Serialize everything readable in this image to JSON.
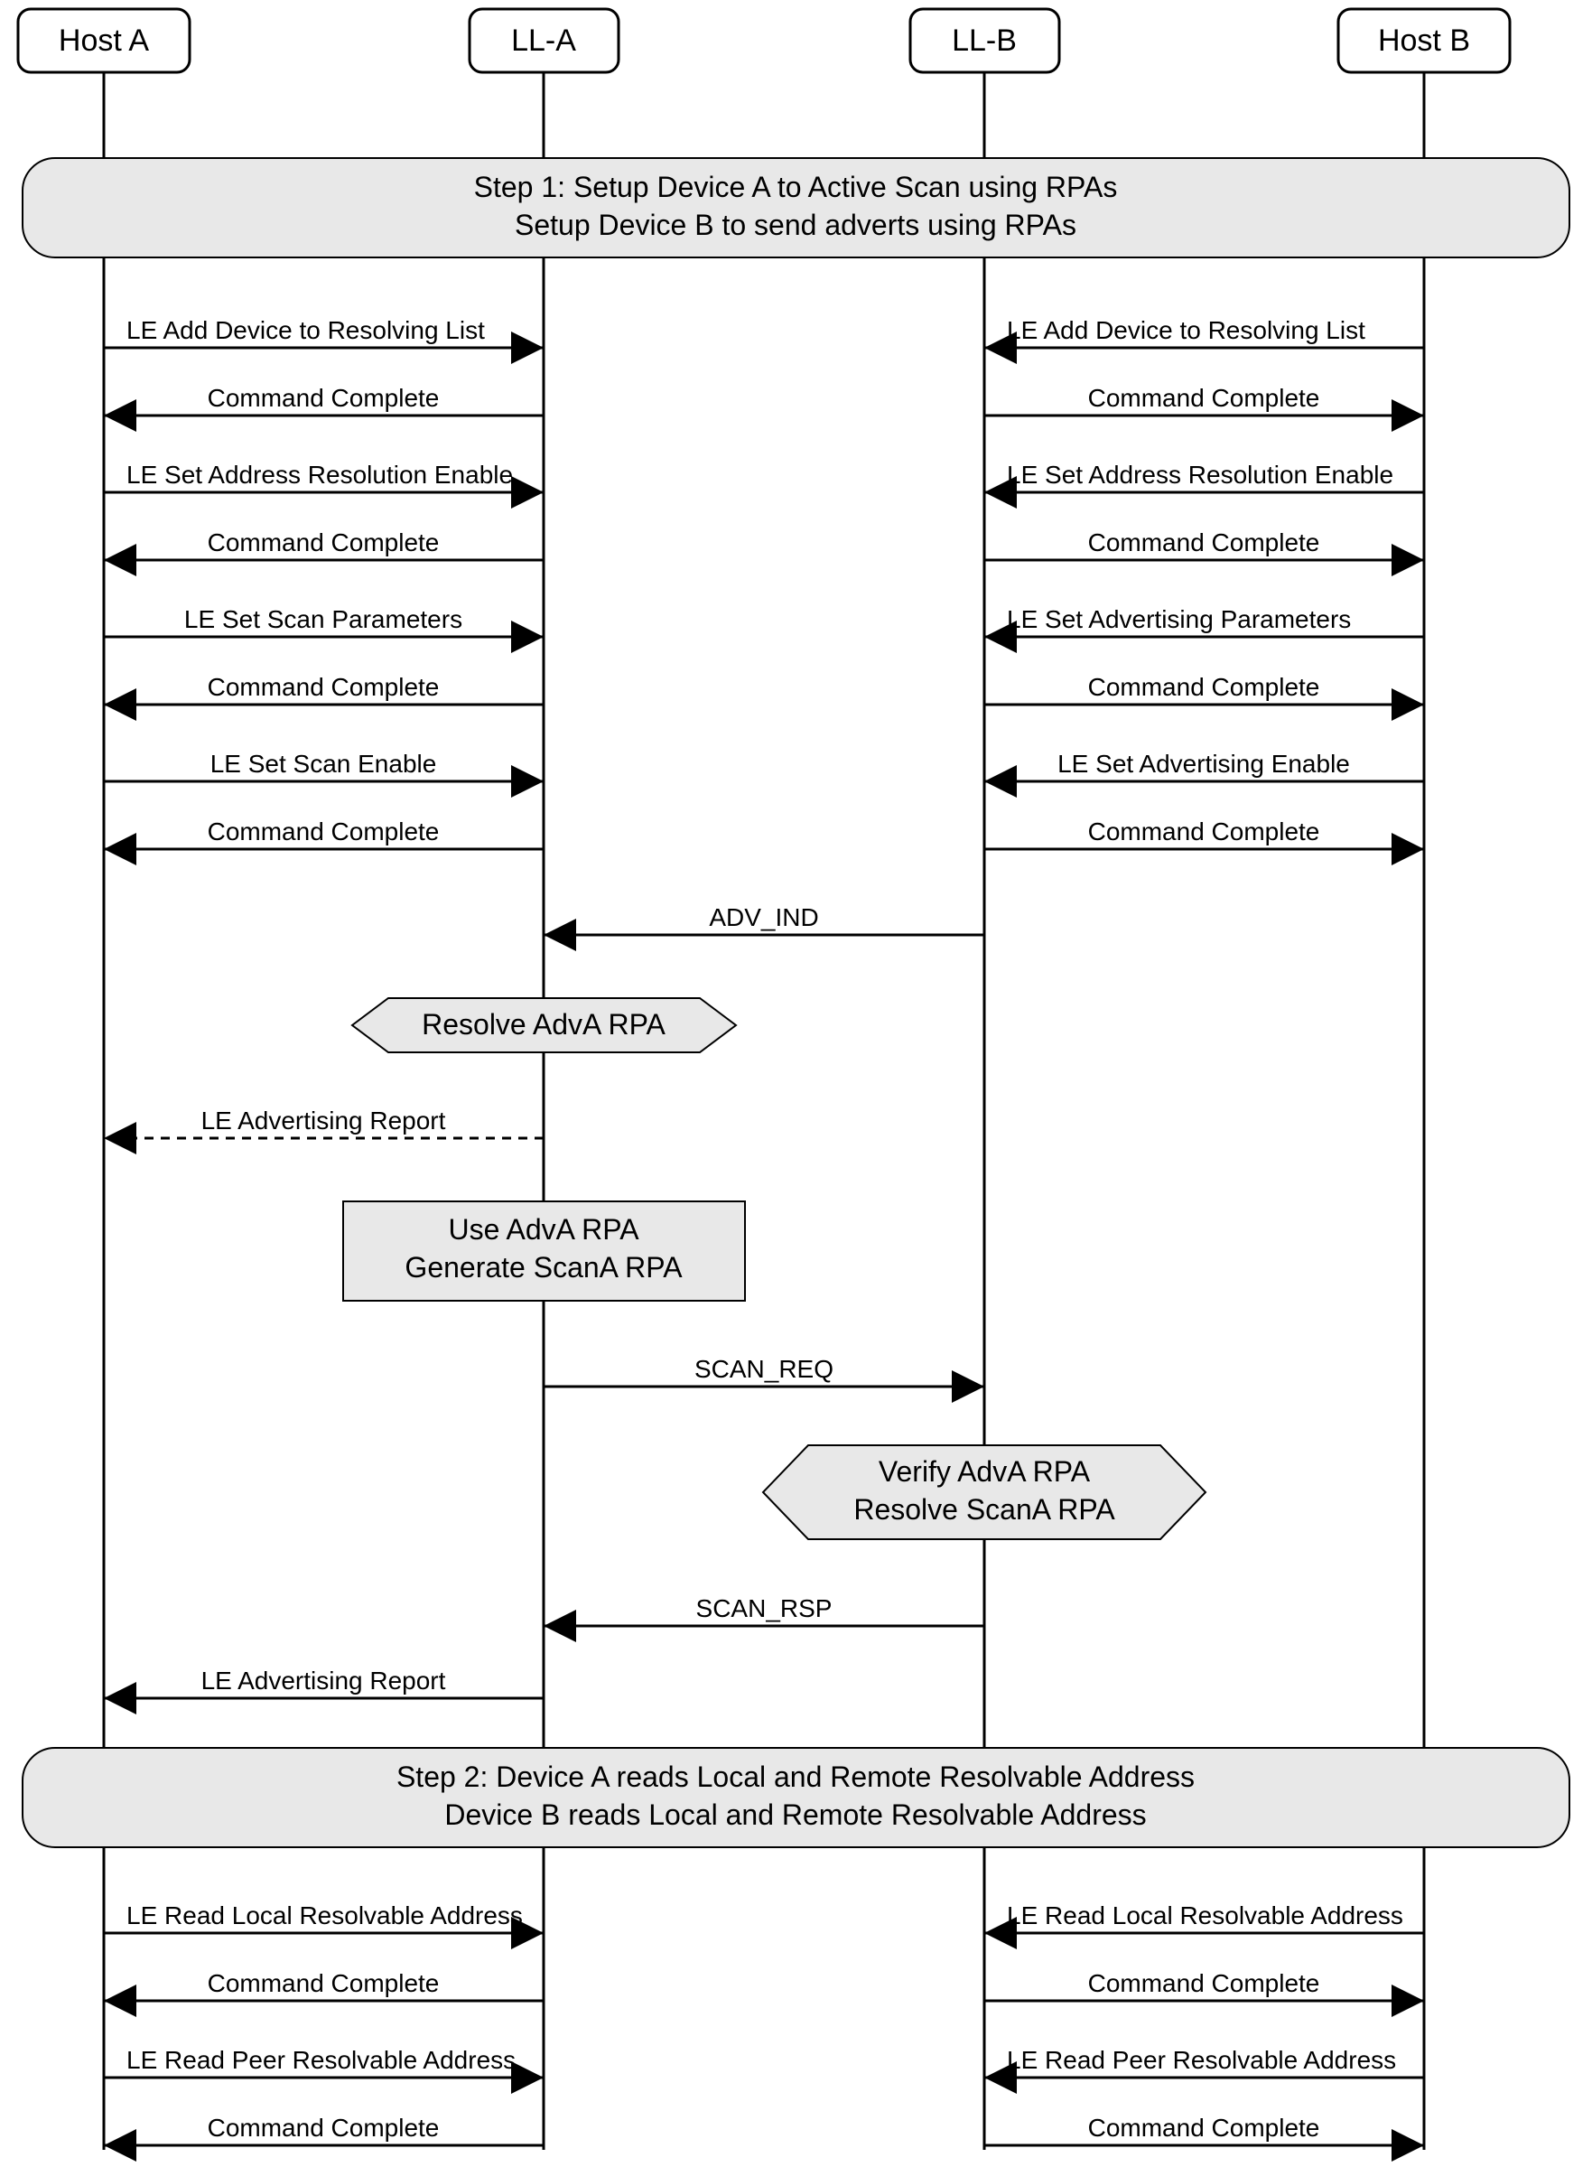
{
  "participants": {
    "hostA": "Host A",
    "llA": "LL-A",
    "llB": "LL-B",
    "hostB": "Host B"
  },
  "step1": {
    "line1": "Step 1:  Setup Device A to Active Scan using RPAs",
    "line2": "Setup Device B to send adverts using RPAs"
  },
  "step2": {
    "line1": "Step 2:  Device A reads Local and Remote Resolvable Address",
    "line2": "Device B reads Local and Remote Resolvable Address"
  },
  "msgs": {
    "addDevResolve": "LE Add Device to Resolving List",
    "cmdComplete1": "Command Complete",
    "setAddrRes": "LE Set Address Resolution Enable",
    "cmdComplete2": "Command Complete",
    "setScanParams": "LE Set Scan Parameters",
    "setAdvParams": "LE Set Advertising Parameters",
    "cmdComplete3": "Command Complete",
    "setScanEnable": "LE Set Scan Enable",
    "setAdvEnable": "LE Set Advertising Enable",
    "cmdComplete4": "Command Complete",
    "advInd": "ADV_IND",
    "advReport1": "LE Advertising Report",
    "scanReq": "SCAN_REQ",
    "scanRsp": "SCAN_RSP",
    "advReport2": "LE Advertising Report",
    "readLocal": "LE Read Local Resolvable Address",
    "cmdComplete5": "Command Complete",
    "readPeer": "LE Read Peer Resolvable Address",
    "cmdComplete6": "Command Complete"
  },
  "notes": {
    "resolveAdvA": "Resolve AdvA RPA",
    "useAdvA_l1": "Use AdvA RPA",
    "useAdvA_l2": "Generate ScanA RPA",
    "verify_l1": "Verify AdvA RPA",
    "verify_l2": "Resolve ScanA RPA"
  }
}
